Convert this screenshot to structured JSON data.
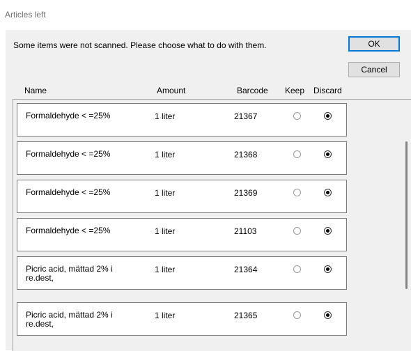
{
  "window": {
    "title": "Articles left"
  },
  "message": "Some items were not scanned. Please choose what to do with them.",
  "buttons": {
    "ok": "OK",
    "cancel": "Cancel"
  },
  "columns": {
    "name": "Name",
    "amount": "Amount",
    "barcode": "Barcode",
    "keep": "Keep",
    "discard": "Discard"
  },
  "items": [
    {
      "name": "Formaldehyde < =25%",
      "amount": "1 liter",
      "barcode": "21367",
      "choice": "discard"
    },
    {
      "name": "Formaldehyde < =25%",
      "amount": "1 liter",
      "barcode": "21368",
      "choice": "discard"
    },
    {
      "name": "Formaldehyde < =25%",
      "amount": "1 liter",
      "barcode": "21369",
      "choice": "discard"
    },
    {
      "name": "Formaldehyde < =25%",
      "amount": "1 liter",
      "barcode": "21103",
      "choice": "discard"
    },
    {
      "name": "Picric acid, mättad 2% i re.dest,",
      "amount": "1 liter",
      "barcode": "21364",
      "choice": "discard"
    },
    {
      "name": "Picric acid, mättad 2% i re.dest,",
      "amount": "1 liter",
      "barcode": "21365",
      "choice": "discard"
    }
  ]
}
